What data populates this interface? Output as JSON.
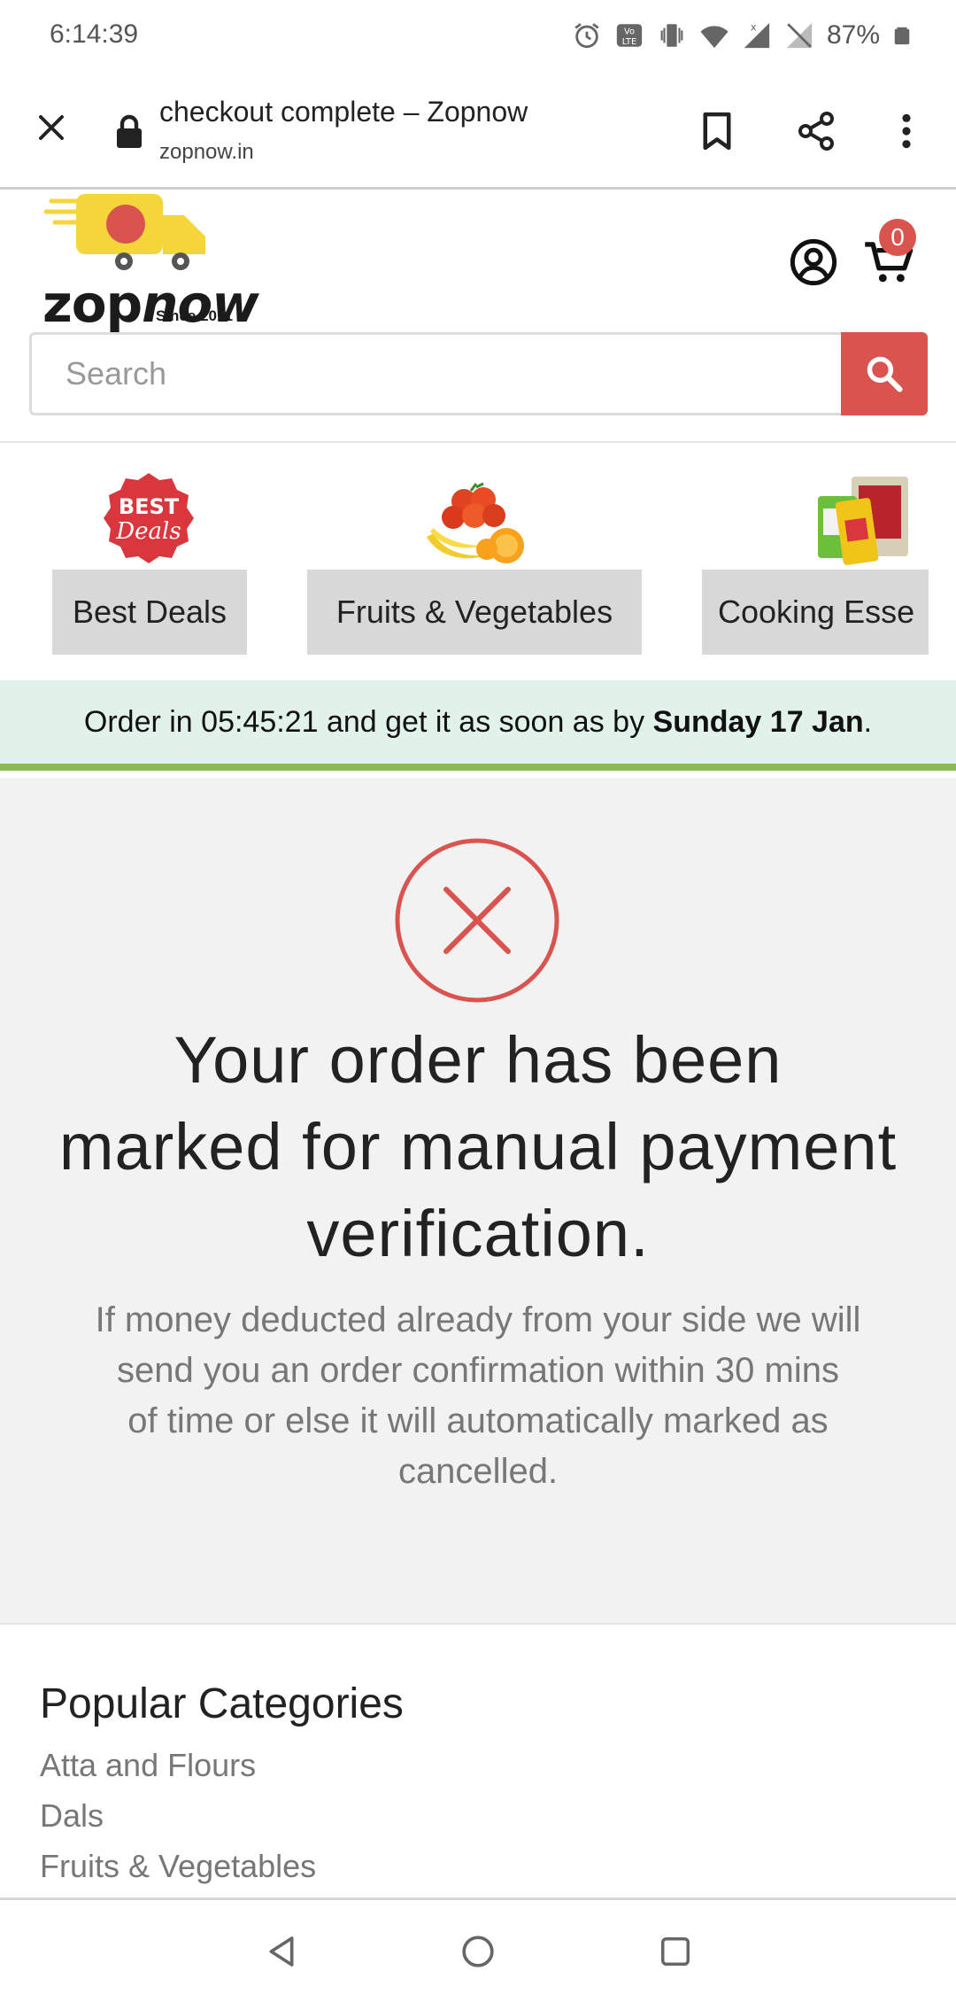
{
  "status_bar": {
    "time": "6:14:39",
    "battery": "87%",
    "icons": [
      "alarm-icon",
      "volte-icon",
      "vibrate-icon",
      "wifi-icon",
      "signal-icon",
      "no-signal-icon",
      "battery-icon"
    ]
  },
  "browser": {
    "page_title": "checkout complete – Zopnow",
    "domain": "zopnow.in"
  },
  "header": {
    "logo_word_a": "zop",
    "logo_word_b": "now",
    "logo_since": "Since 2011",
    "cart_count": "0",
    "search_placeholder": "Search"
  },
  "categories": [
    {
      "label": "Best Deals",
      "badge_line1": "BEST",
      "badge_line2": "Deals"
    },
    {
      "label": "Fruits & Vegetables"
    },
    {
      "label": "Cooking Esse"
    }
  ],
  "banner": {
    "prefix": "Order in 05:45:21 and get it as soon as by ",
    "date": "Sunday 17 Jan",
    "suffix": "."
  },
  "main": {
    "heading": "Your order has been marked for manual payment verification.",
    "desc_1": "If money deducted already from your side we will send you an order confirmation within 30 mins",
    "desc_2": "of time or else it will automatically marked as cancelled."
  },
  "popular": {
    "title": "Popular Categories",
    "items": [
      "Atta and Flours",
      "Dals",
      "Fruits & Vegetables"
    ]
  },
  "colors": {
    "accent": "#d9534f",
    "banner_bg": "#e0f2ea",
    "banner_border": "#8cbc4d",
    "logo_truck": "#f4d63b"
  }
}
